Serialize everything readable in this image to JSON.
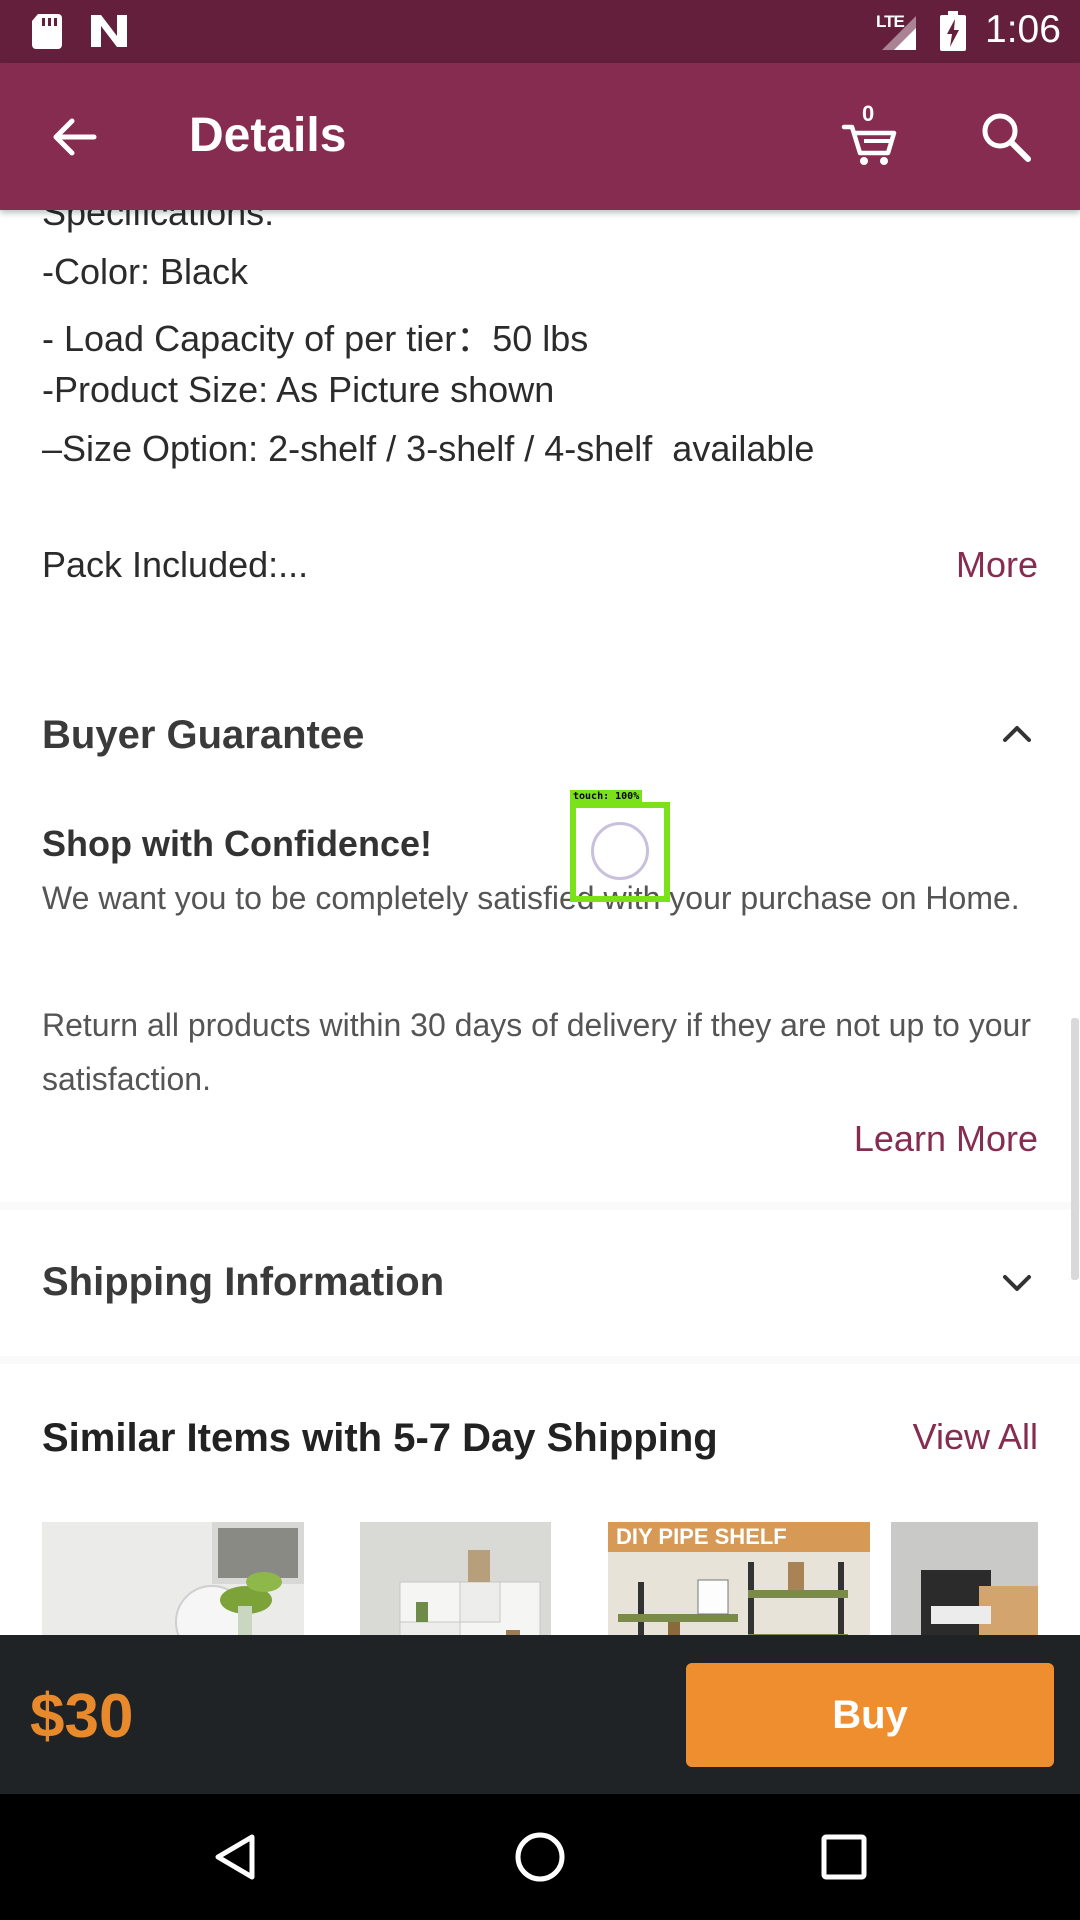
{
  "status_bar": {
    "network": "LTE",
    "time": "1:06"
  },
  "app_bar": {
    "title": "Details",
    "cart_count": "0"
  },
  "specifications": {
    "lines": [
      "Specifications:",
      "-Color: Black",
      "- Load Capacity of per tier：50 lbs",
      "-Product Size: As Picture shown",
      "–Size Option: 2-shelf / 3-shelf / 4-shelf  available"
    ],
    "pack_included": "Pack Included:...",
    "more_label": "More"
  },
  "buyer_guarantee": {
    "heading": "Buyer Guarantee",
    "subheading": "Shop with Confidence!",
    "paragraph_1": "We want you to be completely satisfied with your purchase on Home.",
    "paragraph_2": "Return all products within 30 days of delivery if they are not up to your satisfaction.",
    "learn_more_label": "Learn More"
  },
  "shipping_information": {
    "heading": "Shipping Information"
  },
  "similar_items": {
    "heading": "Similar Items with 5-7 Day Shipping",
    "view_all_label": "View All",
    "thumb_3_banner": "DIY PIPE SHELF"
  },
  "price_bar": {
    "price": "$30",
    "buy_label": "Buy"
  },
  "touch_overlay": {
    "label": "touch: 100%"
  },
  "colors": {
    "status_bar": "#641f3d",
    "app_bar": "#862c50",
    "accent_link": "#862c50",
    "price": "#e8892c",
    "buy_button": "#ef8e2e",
    "bottom_bar": "#1f2326"
  }
}
